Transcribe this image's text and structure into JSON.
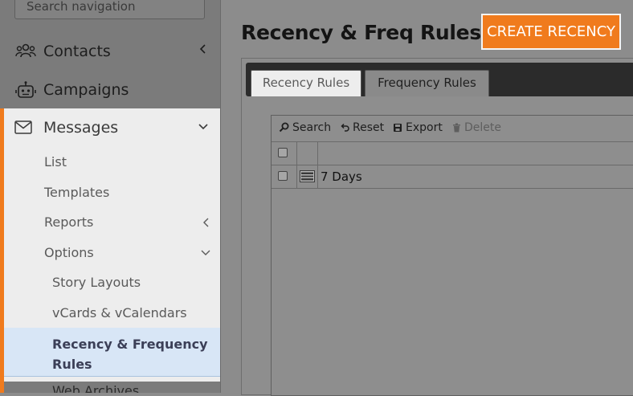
{
  "sidebar": {
    "search_placeholder": "Search navigation",
    "contacts_label": "Contacts",
    "campaigns_label": "Campaigns",
    "messages_label": "Messages",
    "messages_items": {
      "list": "List",
      "templates": "Templates",
      "reports": "Reports",
      "options": "Options"
    },
    "options_items": {
      "story_layouts": "Story Layouts",
      "vcards": "vCards & vCalendars",
      "recency": "Recency & Frequency Rules",
      "web_archives": "Web Archives"
    }
  },
  "main": {
    "title": "Recency & Freq Rules",
    "create_button": "CREATE RECENCY",
    "tabs": [
      "Recency Rules",
      "Frequency Rules"
    ],
    "toolbar": {
      "search": "Search",
      "reset": "Reset",
      "export": "Export",
      "delete": "Delete"
    },
    "rows": [
      {
        "name": "7 Days"
      }
    ]
  },
  "colors": {
    "accent": "#f07b1d",
    "active_item_bg": "#d8e6f6",
    "tab_bar": "#2b2b2b"
  }
}
